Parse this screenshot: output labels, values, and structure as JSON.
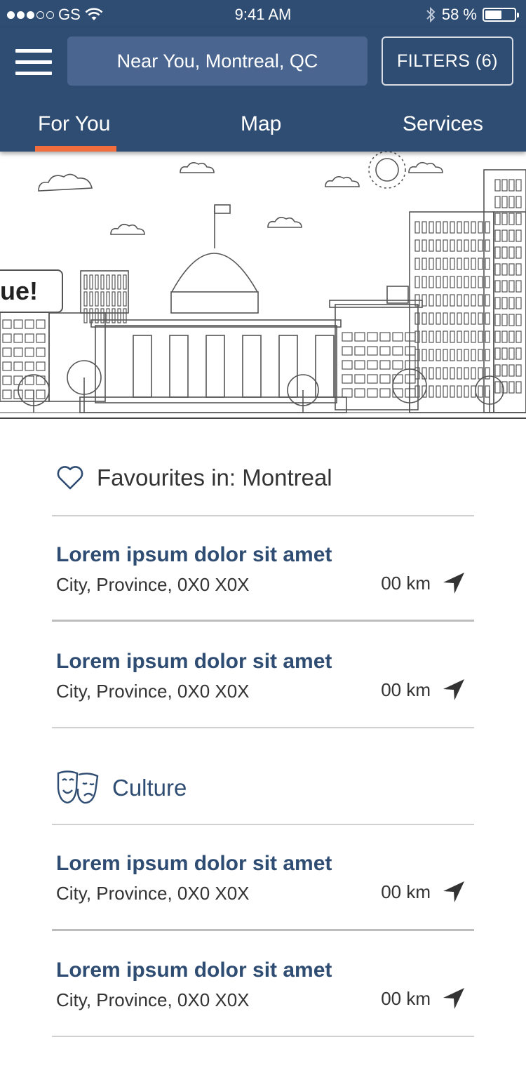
{
  "status_bar": {
    "carrier": "GS",
    "time": "9:41 AM",
    "battery": "58 %",
    "battery_level": 0.58
  },
  "header": {
    "search_value": "Near You, Montreal, QC",
    "filters_label": "FILTERS (6)",
    "tabs": [
      {
        "label": "For You",
        "active": true
      },
      {
        "label": "Map",
        "active": false
      },
      {
        "label": "Services",
        "active": false
      }
    ],
    "accent_color": "#f26d3d",
    "brand_color": "#2f4d73"
  },
  "banner": {
    "bubble_text": "ue!"
  },
  "sections": [
    {
      "title": "Favourites in: Montreal",
      "icon": "heart-icon",
      "items": [
        {
          "name": "Lorem ipsum dolor sit amet",
          "address": "City, Province, 0X0 X0X",
          "distance": "00 km"
        },
        {
          "name": "Lorem ipsum dolor sit amet",
          "address": "City, Province, 0X0 X0X",
          "distance": "00 km"
        }
      ]
    },
    {
      "title": "Culture",
      "icon": "theatre-masks-icon",
      "items": [
        {
          "name": "Lorem ipsum dolor sit amet",
          "address": "City, Province, 0X0 X0X",
          "distance": "00 km"
        },
        {
          "name": "Lorem ipsum dolor sit amet",
          "address": "City, Province, 0X0 X0X",
          "distance": "00 km"
        }
      ]
    }
  ]
}
